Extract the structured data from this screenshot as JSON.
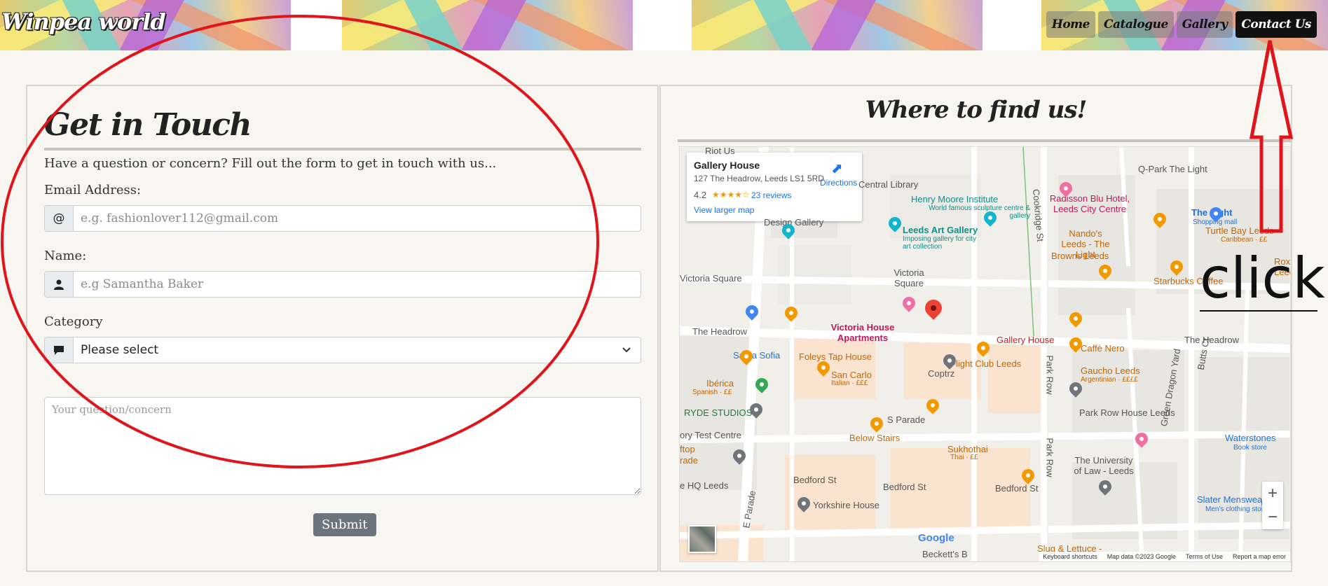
{
  "header": {
    "brand": "Winpea world",
    "nav": [
      {
        "label": "Home",
        "active": false
      },
      {
        "label": "Catalogue",
        "active": false
      },
      {
        "label": "Gallery",
        "active": false
      },
      {
        "label": "Contact Us",
        "active": true
      }
    ]
  },
  "form": {
    "title": "Get in Touch",
    "intro": "Have a question or concern? Fill out the form to get in touch with us...",
    "email_label": "Email Address:",
    "email_icon": "@",
    "email_placeholder": "e.g. fashionlover112@gmail.com",
    "name_label": "Name:",
    "name_placeholder": "e.g Samantha Baker",
    "category_label": "Category",
    "category_selected": "Please select",
    "message_placeholder": "Your question/concern",
    "submit_label": "Submit"
  },
  "map": {
    "title": "Where to find us!",
    "card": {
      "name": "Gallery House",
      "address": "127 The Headrow, Leeds LS1 5RD",
      "rating": "4.2",
      "stars": "★★★★☆",
      "reviews": "23 reviews",
      "larger_map": "View larger map",
      "directions": "Directions"
    },
    "labels": {
      "riot_us": "Riot Us",
      "central_library": "Central Library",
      "henry_moore": "Henry Moore Institute",
      "henry_moore_sub": "World famous sculpture centre & gallery",
      "design_gallery": "Design Gallery",
      "leeds_art_gallery": "Leeds Art Gallery",
      "leeds_art_gallery_sub": "Imposing gallery for city art collection",
      "victoria_square_street": "Victoria Square",
      "victoria_square": "Victoria Square",
      "the_headrow_left": "The Headrow",
      "the_headrow_right": "The Headrow",
      "santa_sofia": "Santa Sofia",
      "victoria_house": "Victoria House Apartments",
      "gallery_house": "Gallery House",
      "caffe_nero": "Caffè Nero",
      "foleys": "Foleys Tap House",
      "flight_club": "Flight Club Leeds",
      "coptrz": "Coptrz",
      "gaucho": "Gaucho Leeds",
      "gaucho_sub": "Argentinian · ££££",
      "iberica": "Ibérica",
      "iberica_sub": "Spanish · ££",
      "san_carlo": "San Carlo",
      "san_carlo_sub": "Italian · £££",
      "ryde": "RYDE STUDIOS",
      "park_row_house": "Park Row House Leeds",
      "s_parade": "S Parade",
      "below_stairs": "Below Stairs",
      "sukhothai": "Sukhothai",
      "sukhothai_sub": "Thai · ££",
      "test_centre": "ory Test Centre",
      "bedford_1": "Bedford St",
      "bedford_2": "Bedford St",
      "bedford_3": "Bedford St",
      "hq_leeds": "e HQ Leeds",
      "yorkshire_house": "Yorkshire House",
      "university": "The University of Law - Leeds",
      "slater": "Slater Menswear",
      "slater_sub": "Men's clothing store",
      "waterstones": "Waterstones",
      "waterstones_sub": "Book store",
      "qpark": "Q-Park The Light",
      "radisson": "Radisson Blu Hotel, Leeds City Centre",
      "the_light": "The Light",
      "the_light_sub": "Shopping mall",
      "turtle_bay": "Turtle Bay Leeds",
      "turtle_bay_sub": "Caribbean · ££",
      "nandos": "Nando's Leeds - The Light",
      "browns": "Browns Leeds",
      "starbucks": "Starbucks Coffee",
      "roxy": "Roxy Leed",
      "cookridge": "Cookridge St",
      "park_row_1": "Park Row",
      "park_row_2": "Park Row",
      "green_dragon": "Green Dragon Yard",
      "butts_ct": "Butts Ct",
      "e_parade": "E Parade",
      "beckett": "Beckett's B",
      "slug": "Slug & Lettuce -",
      "leftop": "ftop",
      "rade": "rade"
    },
    "google": "Google",
    "footer": [
      "Keyboard shortcuts",
      "Map data ©2023 Google",
      "Terms of Use",
      "Report a map error"
    ]
  },
  "annotation": {
    "text": "click",
    "color": "#e0141b"
  }
}
